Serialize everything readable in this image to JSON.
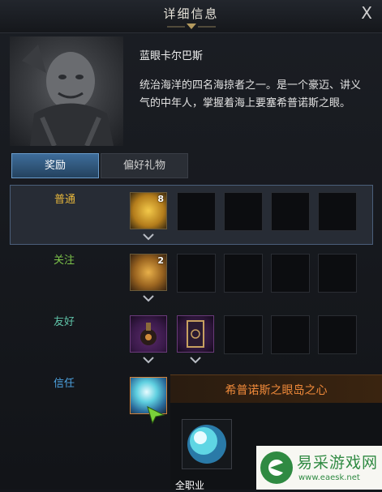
{
  "window": {
    "title": "详细信息",
    "close_label": "X"
  },
  "character": {
    "name": "蓝眼卡尔巴斯",
    "description": "统治海洋的四名海掠者之一。是一个豪迈、讲义气的中年人，掌握着海上要塞希普诺斯之眼。"
  },
  "tabs": [
    {
      "label": "奖励",
      "active": true
    },
    {
      "label": "偏好礼物",
      "active": false
    }
  ],
  "reward_rows": [
    {
      "label": "普通",
      "color": "#e8b83c",
      "items": [
        {
          "name": "gold-coin-icon",
          "qty": "8"
        }
      ]
    },
    {
      "label": "关注",
      "color": "#7cc24a",
      "items": [
        {
          "name": "gold-medallion-icon",
          "qty": "2"
        }
      ]
    },
    {
      "label": "友好",
      "color": "#5fc3a8",
      "items": [
        {
          "name": "purple-flask-icon",
          "qty": ""
        },
        {
          "name": "card-icon",
          "qty": ""
        }
      ]
    },
    {
      "label": "信任",
      "color": "#4da3e0",
      "items": [
        {
          "name": "ocean-orb-icon",
          "qty": ""
        }
      ]
    }
  ],
  "tooltip": {
    "title": "希普诺斯之眼岛之心",
    "class_label": "全职业"
  },
  "watermark": {
    "text": "易采游戏网",
    "url": "www.eaesk.net"
  }
}
